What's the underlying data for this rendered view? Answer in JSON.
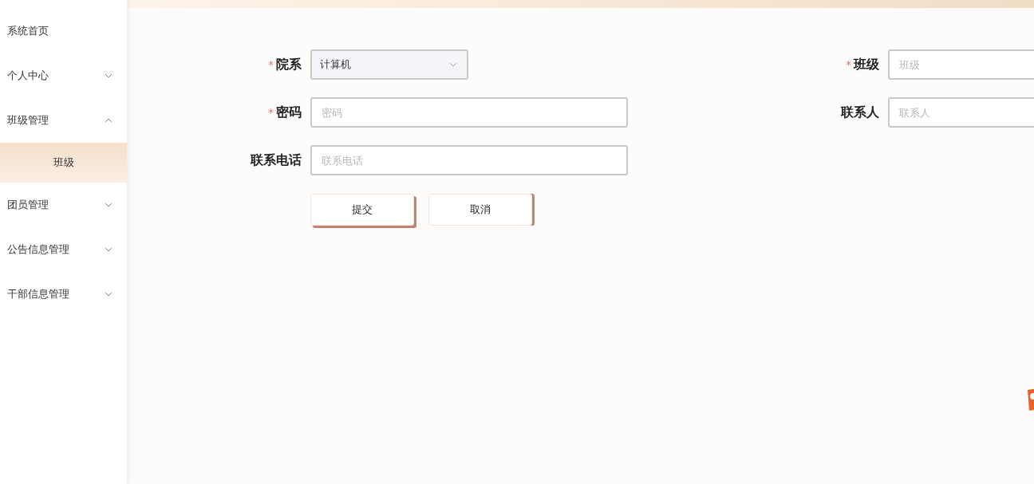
{
  "sidebar": {
    "items": [
      {
        "label": "系统首页"
      },
      {
        "label": "个人中心",
        "expanded": false
      },
      {
        "label": "班级管理",
        "expanded": true,
        "children": [
          {
            "label": "班级",
            "selected": true
          }
        ]
      },
      {
        "label": "团员管理",
        "expanded": false
      },
      {
        "label": "公告信息管理",
        "expanded": false
      },
      {
        "label": "干部信息管理",
        "expanded": false
      }
    ]
  },
  "form": {
    "fields": [
      {
        "label": "院系",
        "required_mark": "*",
        "kind": "select",
        "value": "计算机"
      },
      {
        "label": "班级",
        "required_mark": "*",
        "kind": "input",
        "placeholder": "班级"
      },
      {
        "label": "密码",
        "required_mark": "*",
        "kind": "input",
        "placeholder": "密码"
      },
      {
        "label": "联系人",
        "kind": "input",
        "placeholder": "联系人"
      },
      {
        "label": "联系电话",
        "kind": "input",
        "placeholder": "联系电话"
      }
    ],
    "buttons": [
      "提交",
      "取消"
    ]
  }
}
